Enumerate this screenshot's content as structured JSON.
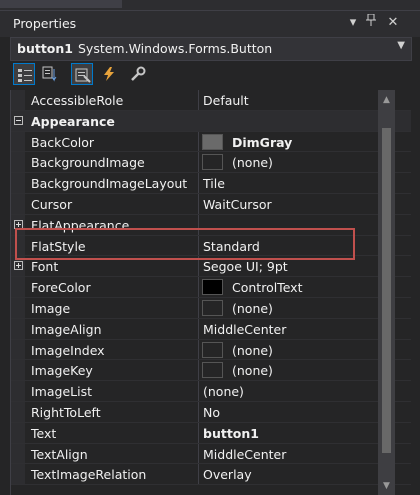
{
  "panel": {
    "title": "Properties",
    "icons": {
      "dropdown": "chevron-down-icon",
      "pin": "pin-icon",
      "close": "close-icon"
    }
  },
  "object_selector": {
    "name": "button1",
    "type": "System.Windows.Forms.Button"
  },
  "toolbar": {
    "tools": [
      {
        "icon": "categorized-icon",
        "active": true
      },
      {
        "icon": "alphabetical-icon",
        "active": false
      },
      {
        "icon": "properties-icon",
        "active": true
      },
      {
        "icon": "events-icon",
        "active": false
      },
      {
        "icon": "property-pages-icon",
        "active": false
      }
    ]
  },
  "rows": [
    {
      "name": "AccessibleRole",
      "value": "Default"
    },
    {
      "name": "Appearance",
      "category": true
    },
    {
      "name": "BackColor",
      "value": "DimGray",
      "swatch": "#6a6a6a",
      "bold": true
    },
    {
      "name": "BackgroundImage",
      "value": "(none)",
      "swatch": "#252526"
    },
    {
      "name": "BackgroundImageLayout",
      "value": "Tile"
    },
    {
      "name": "Cursor",
      "value": "WaitCursor"
    },
    {
      "name": "FlatAppearance",
      "value": "",
      "expand": "plus"
    },
    {
      "name": "FlatStyle",
      "value": "Standard"
    },
    {
      "name": "Font",
      "value": "Segoe UI; 9pt",
      "expand": "plus"
    },
    {
      "name": "ForeColor",
      "value": "ControlText",
      "swatch": "#000000"
    },
    {
      "name": "Image",
      "value": "(none)",
      "swatch": "#252526"
    },
    {
      "name": "ImageAlign",
      "value": "MiddleCenter"
    },
    {
      "name": "ImageIndex",
      "value": "(none)",
      "swatch": "#252526"
    },
    {
      "name": "ImageKey",
      "value": "(none)",
      "swatch": "#252526"
    },
    {
      "name": "ImageList",
      "value": "(none)"
    },
    {
      "name": "RightToLeft",
      "value": "No"
    },
    {
      "name": "Text",
      "value": "button1",
      "bold": true
    },
    {
      "name": "TextAlign",
      "value": "MiddleCenter"
    },
    {
      "name": "TextImageRelation",
      "value": "Overlay"
    }
  ],
  "highlighted_property": "FlatStyle",
  "colors": {
    "background": "#252526",
    "accent": "#007acc",
    "highlight": "#c0504d"
  }
}
